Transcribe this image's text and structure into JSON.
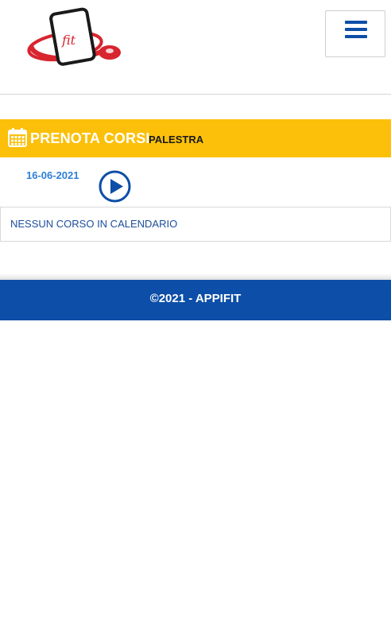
{
  "header": {
    "logo_text": "fit",
    "menu_icon": "hamburger-icon"
  },
  "title_bar": {
    "icon": "calendar-icon",
    "title": "PRENOTA CORSI",
    "subtitle": "PALESTRA"
  },
  "schedule": {
    "date": "16-06-2021",
    "next_icon": "play-circle-icon",
    "empty_message": "NESSUN CORSO IN CALENDARIO"
  },
  "footer": {
    "copyright": "©2021 - APPIFIT"
  },
  "colors": {
    "title_bar_bg": "#fcc00a",
    "footer_bg": "#0c4ea8",
    "accent_blue": "#1b4e9b",
    "date_blue": "#2f7fd6",
    "logo_red": "#d8252f"
  }
}
